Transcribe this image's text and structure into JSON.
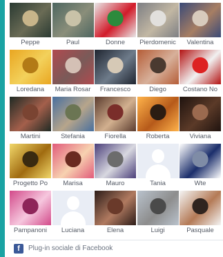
{
  "people": [
    {
      "name": "Peppe",
      "colors": [
        "#2a3a32",
        "#6a6b55",
        "#c8b58a"
      ]
    },
    {
      "name": "Paul",
      "colors": [
        "#4d6660",
        "#8a8e7a",
        "#c9c2a8"
      ]
    },
    {
      "name": "Donne",
      "colors": [
        "#e8e8e8",
        "#d21b2a",
        "#2c8a3c"
      ]
    },
    {
      "name": "Pierdomenic",
      "colors": [
        "#7d7f84",
        "#c2b7a3",
        "#e2e0dd"
      ]
    },
    {
      "name": "Valentina",
      "colors": [
        "#3a4a78",
        "#a77e63",
        "#d8cbbd"
      ]
    },
    {
      "name": "Loredana",
      "colors": [
        "#e9a621",
        "#f3d15b",
        "#b37a16"
      ]
    },
    {
      "name": "Maria Rosar",
      "colors": [
        "#b04a4f",
        "#7a5a58",
        "#d4c0b5"
      ]
    },
    {
      "name": "Francesco",
      "colors": [
        "#1f2530",
        "#6e7b8a",
        "#d6c9b6"
      ]
    },
    {
      "name": "Diego",
      "colors": [
        "#b55d37",
        "#d7b09a",
        "#4a3a30"
      ]
    },
    {
      "name": "Costano No",
      "colors": [
        "#b31212",
        "#f1f1f1",
        "#d22"
      ]
    },
    {
      "name": "Martini",
      "colors": [
        "#1f2a24",
        "#a45f4b",
        "#7a4432"
      ]
    },
    {
      "name": "Stefania",
      "colors": [
        "#486f9e",
        "#b7a58b",
        "#6b7553"
      ]
    },
    {
      "name": "Fiorella",
      "colors": [
        "#5a3b2e",
        "#d2b08f",
        "#7a2e2a"
      ]
    },
    {
      "name": "Roberta",
      "colors": [
        "#ffb34a",
        "#b65a1a",
        "#2b1c12"
      ]
    },
    {
      "name": "Viviana",
      "colors": [
        "#1f130f",
        "#5b3a28",
        "#9b6a4f"
      ]
    },
    {
      "name": "Progetto Po",
      "colors": [
        "#f1d76a",
        "#a06b10",
        "#3a2a10"
      ]
    },
    {
      "name": "Marisa",
      "colors": [
        "#e15a7a",
        "#f7d2b0",
        "#6a2a20"
      ]
    },
    {
      "name": "Mauro",
      "colors": [
        "#4b3f7a",
        "#d8d8e0",
        "#6c6c6c"
      ]
    },
    {
      "name": "Tania",
      "blank": true
    },
    {
      "name": "Wte",
      "colors": [
        "#ffffff",
        "#1b2e6b",
        "#7f8ca6"
      ]
    },
    {
      "name": "Pampanoni",
      "colors": [
        "#d24a8a",
        "#f6c7de",
        "#8e2559"
      ]
    },
    {
      "name": "Luciana",
      "blank": true
    },
    {
      "name": "Elena",
      "colors": [
        "#2c1c18",
        "#b07a60",
        "#6a3a2a"
      ]
    },
    {
      "name": "Luigi",
      "colors": [
        "#b9c2cc",
        "#8d8d8d",
        "#4a4a4a"
      ]
    },
    {
      "name": "Pasquale",
      "colors": [
        "#f4f4f4",
        "#b47a56",
        "#30241f"
      ]
    }
  ],
  "footer": {
    "icon": "f",
    "text": "Plug-in sociale di Facebook"
  }
}
